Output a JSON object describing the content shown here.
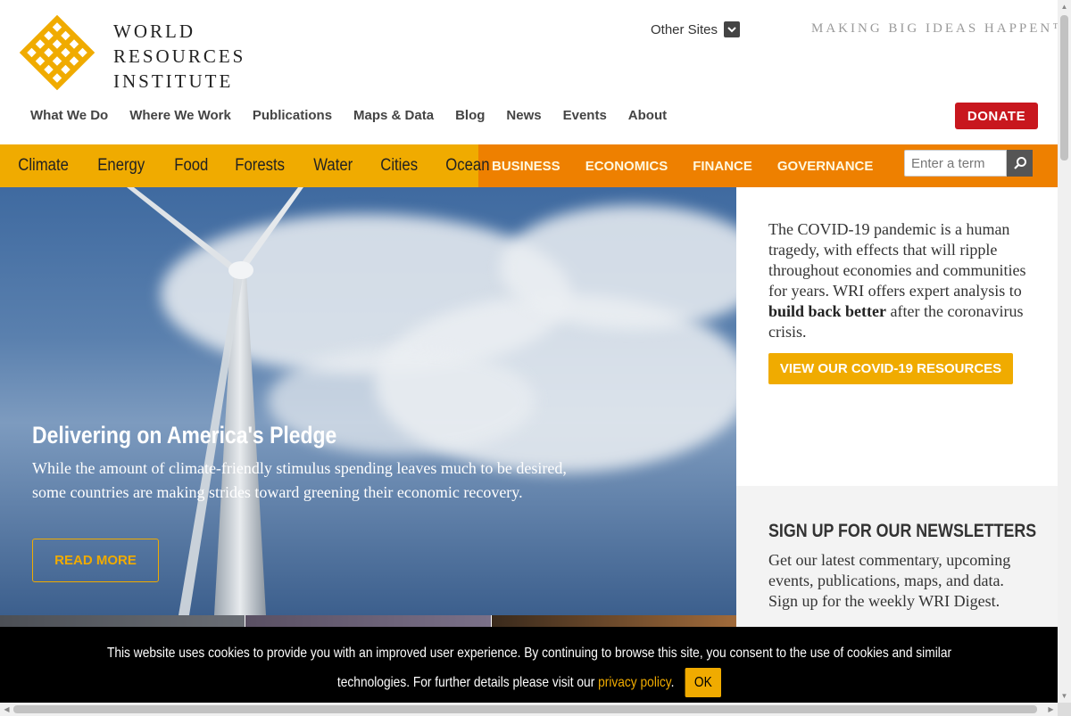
{
  "header": {
    "logo_lines": [
      "WORLD",
      "RESOURCES",
      "INSTITUTE"
    ],
    "other_sites": "Other Sites",
    "tagline": "MAKING BIG IDEAS HAPPEN™",
    "donate": "DONATE"
  },
  "main_nav": [
    "What We Do",
    "Where We Work",
    "Publications",
    "Maps & Data",
    "Blog",
    "News",
    "Events",
    "About"
  ],
  "topics": [
    "Climate",
    "Energy",
    "Food",
    "Forests",
    "Water",
    "Cities",
    "Ocean"
  ],
  "categories": [
    "BUSINESS",
    "ECONOMICS",
    "FINANCE",
    "GOVERNANCE"
  ],
  "search": {
    "placeholder": "Enter a term"
  },
  "hero": {
    "title": "Delivering on America's Pledge",
    "text": "While the amount of climate-friendly stimulus spending leaves much to be desired, some countries are making strides toward greening their economic recovery.",
    "button": "READ MORE"
  },
  "covid": {
    "text_before": "The COVID-19 pandemic is a human tragedy, with effects that will ripple throughout economies and communities for years. WRI offers expert analysis to ",
    "text_bold": "build back better",
    "text_after": " after the coronavirus crisis.",
    "button": "VIEW OUR COVID-19 RESOURCES"
  },
  "newsletter": {
    "title": "SIGN UP FOR OUR NEWSLETTERS",
    "text": "Get our latest commentary, upcoming events, publications, maps, and data. Sign up for the weekly WRI Digest."
  },
  "cookie": {
    "text": "This website uses cookies to provide you with an improved user experience. By continuing to browse this site, you consent to the use of cookies and similar technologies. For further details please visit our ",
    "link": "privacy policy",
    "after": ".",
    "ok": "OK"
  },
  "colors": {
    "brand_yellow": "#f0ab00",
    "brand_orange": "#ee8000",
    "donate_red": "#c8171e"
  }
}
